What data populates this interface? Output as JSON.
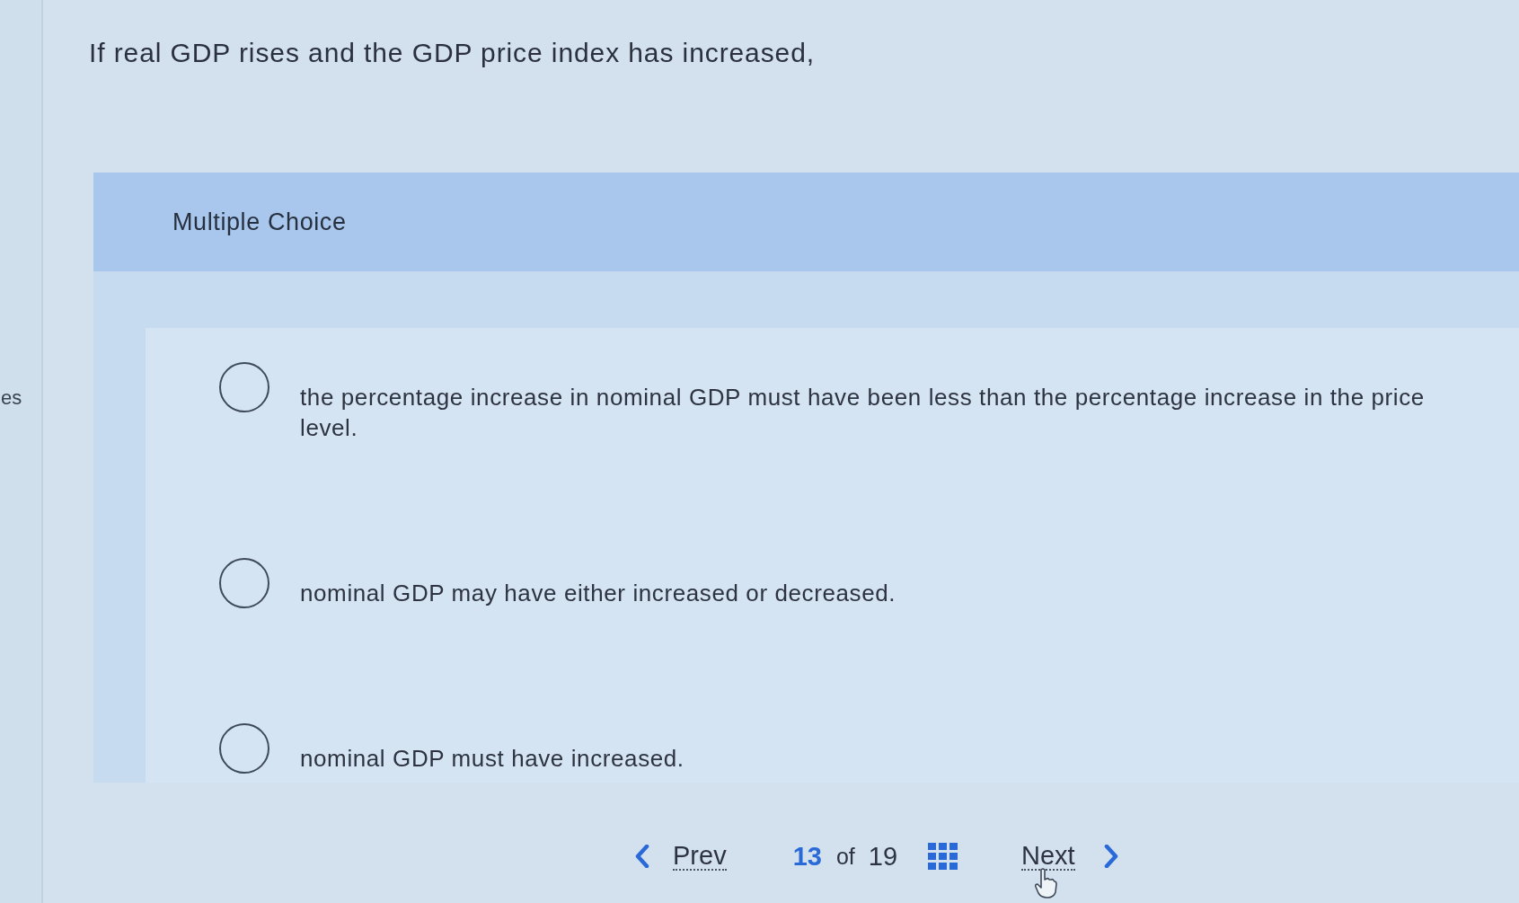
{
  "sidebar": {
    "text": "es"
  },
  "question": {
    "text": "If real GDP rises and the GDP price index has increased,"
  },
  "answer_panel": {
    "heading": "Multiple Choice",
    "options": [
      {
        "text": "the percentage increase in nominal GDP must have been less than the percentage increase in the price level.",
        "selected": false
      },
      {
        "text": "nominal GDP may have either increased or decreased.",
        "selected": false
      },
      {
        "text": "nominal GDP must have increased.",
        "selected": false
      }
    ]
  },
  "navigation": {
    "prev": "Prev",
    "current": "13",
    "separator": "of",
    "total": "19",
    "next": "Next"
  }
}
